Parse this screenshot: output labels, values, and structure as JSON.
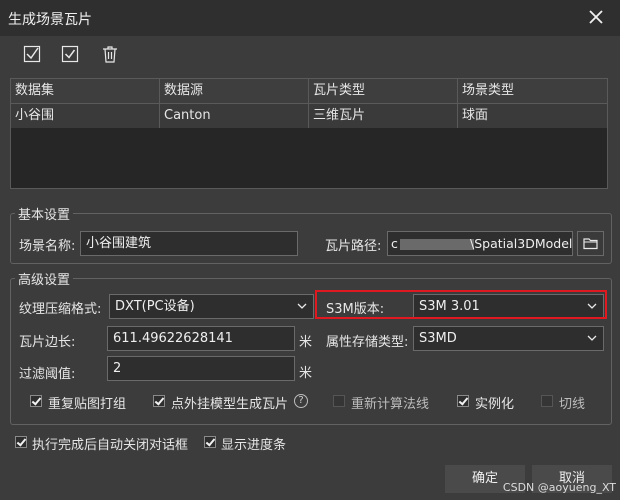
{
  "dialog": {
    "title": "生成场景瓦片",
    "close_icon": "close-icon"
  },
  "toolbar": {
    "icons": [
      "check-square-icon",
      "check-square-icon",
      "trash-icon"
    ]
  },
  "grid": {
    "headers": [
      "数据集",
      "数据源",
      "瓦片类型",
      "场景类型"
    ],
    "rows": [
      [
        "小谷围",
        "Canton",
        "三维瓦片",
        "球面"
      ]
    ]
  },
  "basic": {
    "legend": "基本设置",
    "scene_name_label": "场景名称:",
    "scene_name_value": "小谷围建筑",
    "tile_path_label": "瓦片路径:",
    "tile_path_prefix": "c",
    "tile_path_suffix": "\\Spatial3DModel"
  },
  "advanced": {
    "legend": "高级设置",
    "texture_label": "纹理压缩格式:",
    "texture_value": "DXT(PC设备)",
    "s3m_label": "S3M版本:",
    "s3m_value": "S3M 3.01",
    "tile_side_label": "瓦片边长:",
    "tile_side_value": "611.49622628141",
    "tile_side_unit": "米",
    "attr_label": "属性存储类型:",
    "attr_value": "S3MD",
    "filter_label": "过滤阈值:",
    "filter_value": "2",
    "filter_unit": "米",
    "options": [
      {
        "label": "重复贴图打组",
        "checked": true,
        "enabled": true
      },
      {
        "label": "点外挂模型生成瓦片",
        "checked": true,
        "enabled": true
      },
      {
        "label": "重新计算法线",
        "checked": false,
        "enabled": false
      },
      {
        "label": "实例化",
        "checked": true,
        "enabled": true
      },
      {
        "label": "切线",
        "checked": false,
        "enabled": false
      }
    ],
    "help_glyph": "?"
  },
  "footer": {
    "auto_close_label": "执行完成后自动关闭对话框",
    "auto_close_checked": true,
    "show_progress_label": "显示进度条",
    "show_progress_checked": true,
    "ok_label": "确定",
    "cancel_label": "取消"
  },
  "watermark": "CSDN @aoyueng_XT",
  "colors": {
    "highlight": "#e0181f",
    "background": "#3c3c3c"
  }
}
